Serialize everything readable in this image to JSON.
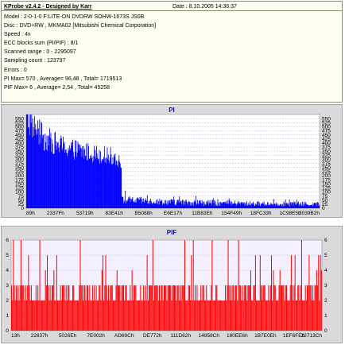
{
  "info": {
    "title": "KProbe v2.4.2 - Designed by Karr",
    "date": "Date : 8.10.2005 14:36:37",
    "lines": [
      "Model : 2-0-1-0 F:LITE-ON DVDRW SOHW-1673S JS0B",
      "Disc : DVD+RW , MKMA02 [Mitsubishi Chemical Corporation]",
      "Speed : 4x",
      "ECC blocks sum (PI/PIF) : 8/1",
      "Scanned range : 0 - 2295097",
      "Sampling count : 123797",
      "Errors : 0",
      "PI Max= 570 , Average= 96,48 , Total= 1719513",
      "PIF Max= 6 , Average= 2,54 , Total= 45258"
    ]
  },
  "chart_data": [
    {
      "type": "bar",
      "title": "PI",
      "ylim": [
        0,
        575
      ],
      "yticks": [
        0,
        25,
        50,
        75,
        100,
        125,
        150,
        175,
        200,
        225,
        250,
        275,
        300,
        325,
        350,
        375,
        400,
        425,
        450,
        475,
        500,
        525,
        550
      ],
      "xtick_labels": [
        "89h",
        "2337Fh",
        "53719h",
        "83E41h",
        "B5088h",
        "E6E17h",
        "11B83Eh",
        "154F49h",
        "18FC33h",
        "1C98E5h",
        "2039B2h"
      ],
      "grid": true,
      "bar_color": "#0000ff",
      "profile": [
        {
          "x": 0.0,
          "y": 560,
          "band": 100,
          "spike": 0.1,
          "spike_y": 570
        },
        {
          "x": 0.02,
          "y": 510,
          "band": 90,
          "spike": 0.08,
          "spike_y": 540
        },
        {
          "x": 0.06,
          "y": 430,
          "band": 80,
          "spike": 0.06,
          "spike_y": 470
        },
        {
          "x": 0.12,
          "y": 380,
          "band": 70,
          "spike": 0.05,
          "spike_y": 420
        },
        {
          "x": 0.2,
          "y": 345,
          "band": 60,
          "spike": 0.05,
          "spike_y": 380
        },
        {
          "x": 0.29,
          "y": 320,
          "band": 55,
          "spike": 0.04,
          "spike_y": 355
        },
        {
          "x": 0.325,
          "y": 290,
          "band": 50,
          "spike": 0.04,
          "spike_y": 330
        },
        {
          "x": 0.33,
          "y": 50,
          "band": 25,
          "spike": 0.08,
          "spike_y": 110
        },
        {
          "x": 0.42,
          "y": 45,
          "band": 22,
          "spike": 0.07,
          "spike_y": 100
        },
        {
          "x": 0.46,
          "y": 40,
          "band": 20,
          "spike": 0.1,
          "spike_y": 160
        },
        {
          "x": 0.5,
          "y": 38,
          "band": 20,
          "spike": 0.06,
          "spike_y": 90
        },
        {
          "x": 0.65,
          "y": 32,
          "band": 18,
          "spike": 0.05,
          "spike_y": 70
        },
        {
          "x": 0.8,
          "y": 28,
          "band": 15,
          "spike": 0.04,
          "spike_y": 60
        },
        {
          "x": 0.95,
          "y": 26,
          "band": 15,
          "spike": 0.04,
          "spike_y": 55
        },
        {
          "x": 1.0,
          "y": 25,
          "band": 15,
          "spike": 0.04,
          "spike_y": 55
        }
      ]
    },
    {
      "type": "bar",
      "title": "PIF",
      "ylim": [
        0,
        6
      ],
      "yticks": [
        0,
        1,
        2,
        3,
        4,
        5,
        6
      ],
      "xtick_labels": [
        "13h",
        "22837h",
        "5026Eh",
        "7E002h",
        "AD69Ch",
        "DE772h",
        "111D62h",
        "14858Ch",
        "180EE6h",
        "1B7E0Eh",
        "1EF6FEh",
        "22713Ch"
      ],
      "grid": true,
      "bar_color": "#ff0000",
      "max": 6,
      "typical_levels": [
        2,
        3
      ],
      "spike_levels": [
        4,
        5
      ]
    }
  ]
}
